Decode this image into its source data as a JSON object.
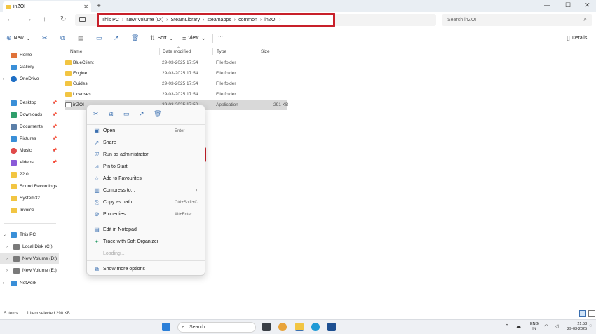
{
  "window": {
    "tab_title": "inZOI",
    "tab_close": "✕",
    "tab_add": "+",
    "controls": [
      "—",
      "☐",
      "✕"
    ]
  },
  "address": {
    "breadcrumb": [
      "This PC",
      "New Volume (D:)",
      "SteamLibrary",
      "steamapps",
      "common",
      "inZOI"
    ],
    "search_placeholder": "Search inZOI"
  },
  "toolbar": {
    "new_label": "New",
    "sort_label": "Sort",
    "view_label": "View",
    "more_label": "···",
    "details_label": "Details"
  },
  "sidebar": {
    "items": [
      {
        "label": "Home",
        "icon": "home-icon",
        "color": "#e0733a"
      },
      {
        "label": "Gallery",
        "icon": "gallery-icon",
        "color": "#3a8fd8"
      },
      {
        "label": "OneDrive",
        "icon": "cloud-icon",
        "color": "#1f6fc5"
      },
      {
        "label": "Desktop",
        "icon": "desktop-icon",
        "color": "#3a8fd8"
      },
      {
        "label": "Downloads",
        "icon": "download-icon",
        "color": "#2f9e6b"
      },
      {
        "label": "Documents",
        "icon": "document-icon",
        "color": "#5b7fa8"
      },
      {
        "label": "Pictures",
        "icon": "picture-icon",
        "color": "#3a8fd8"
      },
      {
        "label": "Music",
        "icon": "music-icon",
        "color": "#e04a4a"
      },
      {
        "label": "Videos",
        "icon": "video-icon",
        "color": "#8a5ad8"
      },
      {
        "label": "22.0",
        "icon": "folder-icon",
        "color": "#f2c542"
      },
      {
        "label": "Sound Recordings",
        "icon": "folder-icon",
        "color": "#f2c542"
      },
      {
        "label": "System32",
        "icon": "folder-icon",
        "color": "#f2c542"
      },
      {
        "label": "Invoice",
        "icon": "folder-icon",
        "color": "#f2c542"
      },
      {
        "label": "This PC",
        "icon": "pc-icon",
        "color": "#3a8fd8"
      },
      {
        "label": "Local Disk (C:)",
        "icon": "drive-icon",
        "color": "#7a7a7a"
      },
      {
        "label": "New Volume (D:)",
        "icon": "drive-icon",
        "color": "#7a7a7a"
      },
      {
        "label": "New Volume (E:)",
        "icon": "drive-icon",
        "color": "#7a7a7a"
      },
      {
        "label": "Network",
        "icon": "network-icon",
        "color": "#3a8fd8"
      }
    ]
  },
  "columns": {
    "name": "Name",
    "date": "Date modified",
    "type": "Type",
    "size": "Size"
  },
  "files": [
    {
      "name": "BlueClient",
      "date": "29-03-2025 17:54",
      "type": "File folder",
      "size": ""
    },
    {
      "name": "Engine",
      "date": "29-03-2025 17:54",
      "type": "File folder",
      "size": ""
    },
    {
      "name": "Guides",
      "date": "29-03-2025 17:54",
      "type": "File folder",
      "size": ""
    },
    {
      "name": "Licenses",
      "date": "29-03-2025 17:54",
      "type": "File folder",
      "size": ""
    },
    {
      "name": "inZOI",
      "date": "29-03-2025 17:50",
      "type": "Application",
      "size": "291 KB"
    }
  ],
  "context_menu": {
    "items": [
      {
        "label": "Open",
        "key": "Enter",
        "icon": "open-icon"
      },
      {
        "label": "Share",
        "key": "",
        "icon": "share-icon"
      },
      {
        "label": "Run as administrator",
        "key": "",
        "icon": "shield-icon"
      },
      {
        "label": "Pin to Start",
        "key": "",
        "icon": "pin-icon"
      },
      {
        "label": "Add to Favourites",
        "key": "",
        "icon": "star-icon"
      },
      {
        "label": "Compress to...",
        "key": "",
        "icon": "zip-icon"
      },
      {
        "label": "Copy as path",
        "key": "Ctrl+Shift+C",
        "icon": "copy-path-icon"
      },
      {
        "label": "Properties",
        "key": "Alt+Enter",
        "icon": "properties-icon"
      },
      {
        "label": "Edit in Notepad",
        "key": "",
        "icon": "notepad-icon"
      },
      {
        "label": "Trace with Soft Organizer",
        "key": "",
        "icon": "trace-icon"
      },
      {
        "label": "Loading...",
        "key": "",
        "icon": ""
      },
      {
        "label": "Show more options",
        "key": "",
        "icon": "more-options-icon"
      }
    ]
  },
  "status": {
    "count": "5 items",
    "selection": "1 item selected  290 KB"
  },
  "taskbar": {
    "search_label": "Search",
    "lang_top": "ENG",
    "lang_bottom": "IN",
    "time": "21:58",
    "date": "29-03-2025"
  },
  "colors": {
    "highlight": "#c8202a",
    "folder": "#f2c542",
    "accent": "#3a6fb0"
  }
}
